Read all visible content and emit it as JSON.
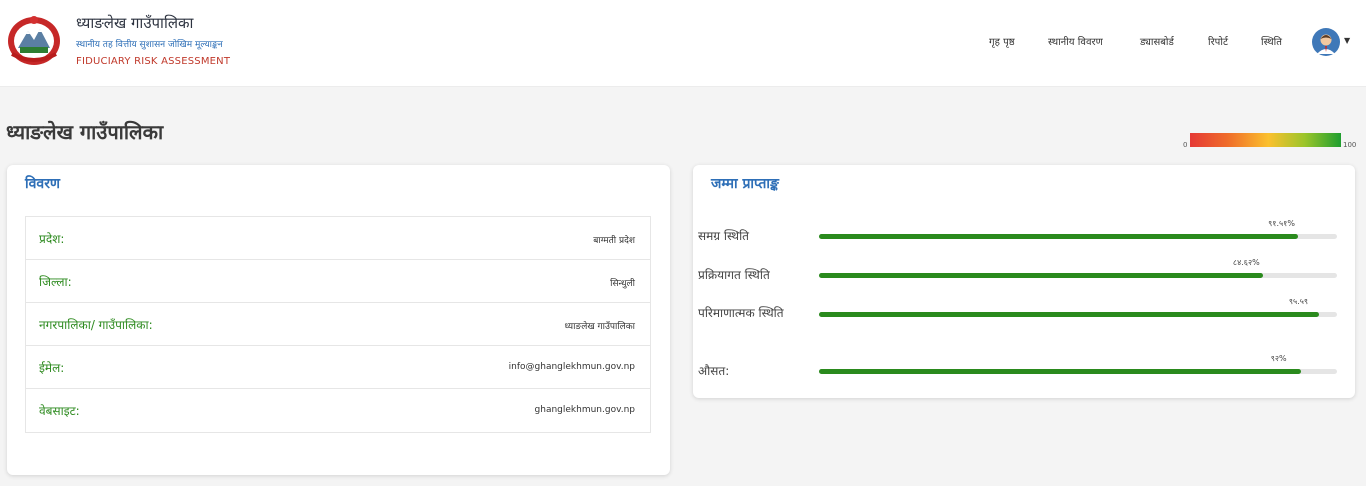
{
  "header": {
    "title": "ध्याङलेख गाउँपालिका",
    "subtitle": "स्थानीय तह वित्तीय सुशासन जोखिम मूल्याङ्कन",
    "english": "FIDUCIARY RISK ASSESSMENT",
    "logo_icon": "nepal-emblem-icon"
  },
  "nav": {
    "items": [
      "गृह पृष्ठ",
      "स्थानीय विवरण",
      "ड्यासबोर्ड",
      "रिपोर्ट",
      "स्थिति"
    ],
    "avatar_icon": "user-avatar-icon",
    "caret_icon": "chevron-down-icon"
  },
  "page": {
    "title": "ध्याङलेख गाउँपालिका",
    "scale": {
      "min": "0",
      "max": "100"
    }
  },
  "details": {
    "title": "विवरण",
    "rows": [
      {
        "label": "प्रदेश:",
        "value": "बाग्मती प्रदेश"
      },
      {
        "label": "जिल्ला:",
        "value": "सिन्धुली"
      },
      {
        "label": "नगरपालिका/ गाउँपालिका:",
        "value": "ध्याङलेख गाउँपालिका"
      },
      {
        "label": "ईमेल:",
        "value": "info@ghanglekhmun.gov.np"
      },
      {
        "label": "वेबसाइट:",
        "value": "ghanglekhmun.gov.np"
      }
    ]
  },
  "scores": {
    "title": "जम्मा प्राप्ताङ्क",
    "items": [
      {
        "label": "समग्र स्थिति",
        "value": "९१.५१%",
        "fraction": 0.925
      },
      {
        "label": "प्रक्रियागत स्थिति",
        "value": "८४.६२%",
        "fraction": 0.857
      },
      {
        "label": "परिमाणात्मक स्थिति",
        "value": "९५.५९",
        "fraction": 0.965
      },
      {
        "label": "औसत:",
        "value": "९२%",
        "fraction": 0.93
      }
    ]
  },
  "colors": {
    "accent_blue": "#2e6fb7",
    "label_green": "#2e8b20",
    "bar_green": "#2a8a1d",
    "brand_red": "#c0392b"
  }
}
